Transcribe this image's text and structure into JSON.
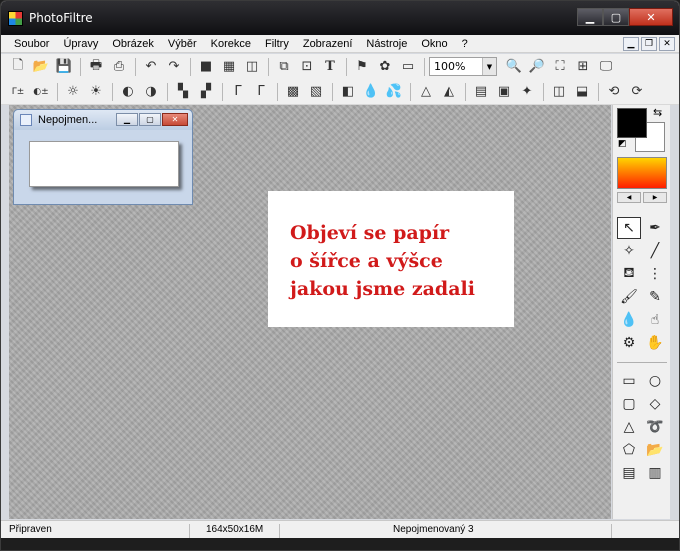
{
  "window": {
    "title": "PhotoFiltre"
  },
  "menu": [
    "Soubor",
    "Úpravy",
    "Obrázek",
    "Výběr",
    "Korekce",
    "Filtry",
    "Zobrazení",
    "Nástroje",
    "Okno",
    "?"
  ],
  "toolbar": {
    "zoom_value": "100%"
  },
  "child_window": {
    "title": "Nepojmen..."
  },
  "note": {
    "lines": [
      "Objeví se papír",
      "o šířce a výšce",
      "jakou jsme zadali"
    ],
    "color": "#d11a1a"
  },
  "palette": {
    "foreground": "#000000",
    "background": "#ffffff",
    "gradient_from": "#ffd400",
    "gradient_to": "#ff1e00"
  },
  "status": {
    "state": "Připraven",
    "image_info": "164x50x16M",
    "document_name": "Nepojmenovaný 3"
  }
}
